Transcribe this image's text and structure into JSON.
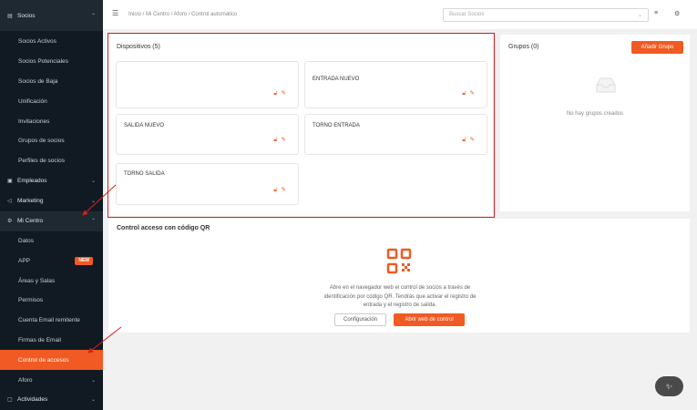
{
  "sidebar": {
    "socios": {
      "label": "Socios",
      "icon": "card-icon"
    },
    "socios_items": [
      "Socios Activos",
      "Socios Potenciales",
      "Socios de Baja",
      "Unificación",
      "Invitaciones",
      "Grupos de socios",
      "Perfiles de socios"
    ],
    "empleados": "Empleados",
    "marketing": "Marketing",
    "mi_centro": "Mi Centro",
    "centro_items": [
      "Datos",
      "APP",
      "Áreas y Salas",
      "Permisos",
      "Cuenta Email remitente",
      "Firmas de Email",
      "Control de accesos"
    ],
    "new_badge": "NEW",
    "aforo": "Aforo",
    "actividades": "Actividades"
  },
  "header": {
    "breadcrumb": "Inicio  /  Mi Centro  /  Aforo  /  Control automático",
    "search_placeholder": "Buscar Socios"
  },
  "devices": {
    "title": "Dispositivos (5)",
    "cards": [
      "",
      "ENTRADA NUEVO",
      "SALIDA NUEVO",
      "TORNO ENTRADA",
      "TORNO SALIDA"
    ]
  },
  "groups": {
    "title": "Grupos (0)",
    "add_button": "Añadir Grupo",
    "empty_text": "No hay grupos creados"
  },
  "qr": {
    "title": "Control acceso con código QR",
    "description": "Abre en el navegador web el control de socios a través de identificación por código QR. Tendrás que activar el registro de entrada y el registro de salida.",
    "config_button": "Configuración",
    "open_button": "Abrir web de control"
  },
  "colors": {
    "accent": "#f15a22",
    "sidebar": "#111a22",
    "highlight": "#d42020"
  }
}
